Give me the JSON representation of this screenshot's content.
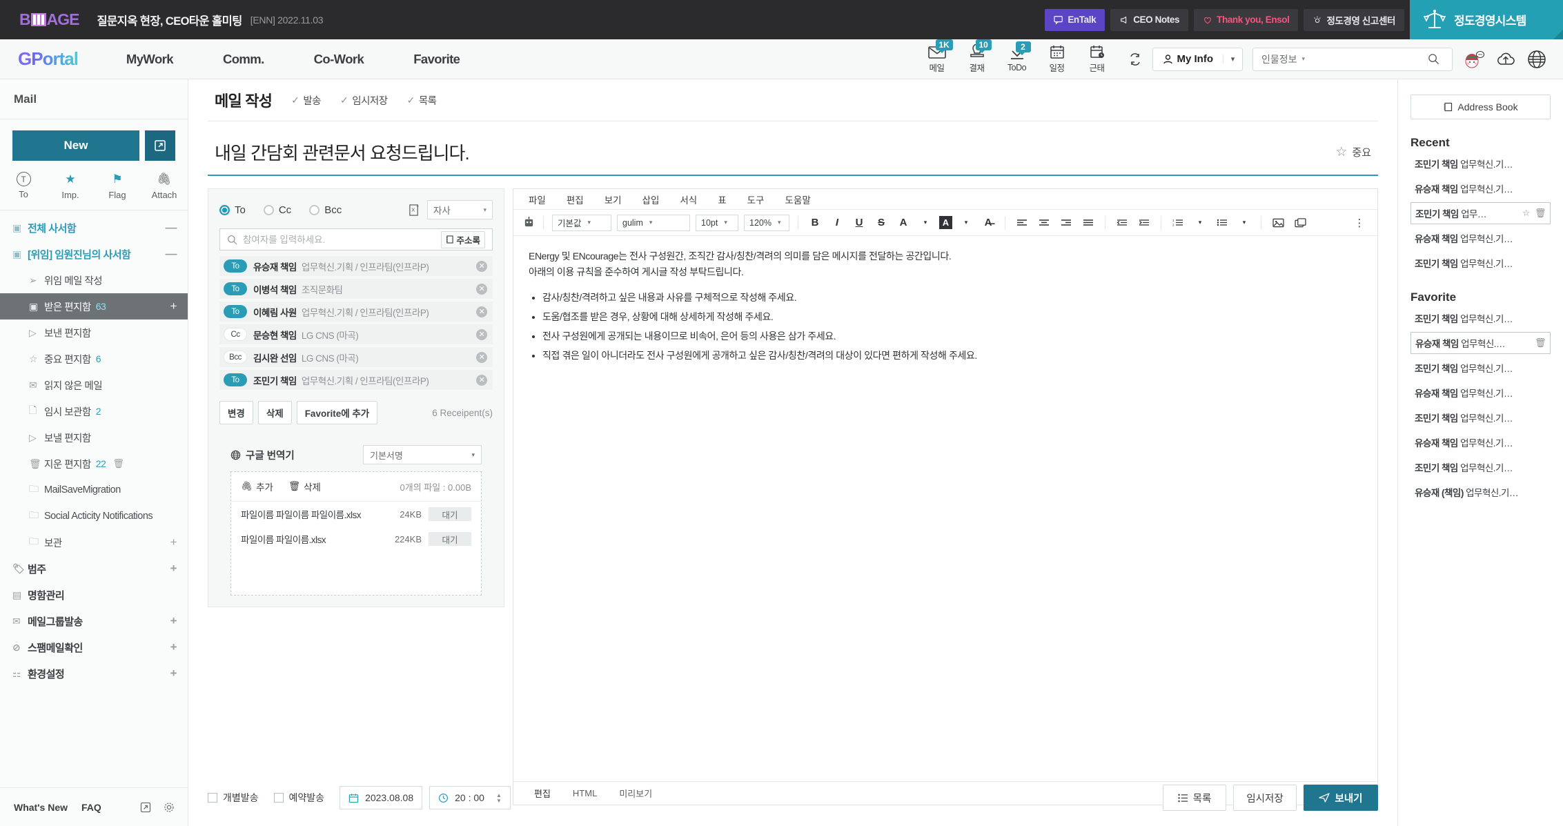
{
  "topbar": {
    "logo_text_left": "B",
    "logo_text_right": "AGE",
    "news_title": "질문지옥 현장, CEO타운 홀미팅",
    "news_date": "[ENN] 2022.11.03",
    "chips": [
      {
        "label": "EnTalk",
        "icon": "chat-icon",
        "style": "violet"
      },
      {
        "label": "CEO Notes",
        "icon": "megaphone-icon",
        "style": "dark"
      },
      {
        "label": "Thank you, Ensol",
        "icon": "heart-icon",
        "style": "dark-pink"
      },
      {
        "label": "정도경영 신고센터",
        "icon": "whistle-icon",
        "style": "dark"
      }
    ],
    "system_label": "정도경영시스템",
    "system_icon": "scales-icon",
    "accent_teal": "#24a0b5",
    "accent_violet": "#5b45c4",
    "pink": "#f5557f"
  },
  "navbar": {
    "brand_g": "G",
    "brand_rest": "Portal",
    "links": [
      "MyWork",
      "Comm.",
      "Co-Work",
      "Favorite"
    ],
    "tools": [
      {
        "label": "메일",
        "badge": "1K",
        "icon": "mail-icon"
      },
      {
        "label": "결재",
        "badge": "10",
        "icon": "stamp-icon"
      },
      {
        "label": "ToDo",
        "badge": "2",
        "icon": "check-icon"
      },
      {
        "label": "일정",
        "badge": "",
        "icon": "calendar-icon"
      },
      {
        "label": "근태",
        "badge": "",
        "icon": "calendar-clock-icon"
      }
    ],
    "refresh_icon": "refresh-icon",
    "myinfo_label": "My Info",
    "search_category": "인물정보",
    "search_value": "",
    "search_placeholder": "",
    "badge_color": "#2b9cb5"
  },
  "sidebar": {
    "title": "Mail",
    "new_label": "New",
    "new_window_icon": "open-in-new-icon",
    "quick": [
      {
        "label": "To",
        "icon": "to-circle-icon"
      },
      {
        "label": "Imp.",
        "icon": "star-icon"
      },
      {
        "label": "Flag",
        "icon": "flag-icon"
      },
      {
        "label": "Attach",
        "icon": "paperclip-icon"
      }
    ],
    "items": [
      {
        "label": "전체 사서함",
        "icon": "inbox-icon",
        "type": "head",
        "count": "",
        "right": "—"
      },
      {
        "label": "[위임] 임원진님의 사서함",
        "icon": "inbox-icon",
        "type": "head",
        "count": "",
        "right": "—"
      },
      {
        "label": "위임 메일 작성",
        "icon": "send-icon",
        "type": "sub",
        "count": "",
        "right": ""
      },
      {
        "label": "받은 편지함",
        "icon": "inbox-icon",
        "type": "sub-selected",
        "count": "63",
        "right": "+"
      },
      {
        "label": "보낸 편지함",
        "icon": "sent-icon",
        "type": "sub",
        "count": "",
        "right": ""
      },
      {
        "label": "중요 편지함",
        "icon": "star-outline-icon",
        "type": "sub",
        "count": "6",
        "right": ""
      },
      {
        "label": "읽지 않은 메일",
        "icon": "unread-icon",
        "type": "sub",
        "count": "",
        "right": ""
      },
      {
        "label": "임시 보관함",
        "icon": "draft-icon",
        "type": "sub",
        "count": "2",
        "right": ""
      },
      {
        "label": "보낼 편지함",
        "icon": "outbox-icon",
        "type": "sub",
        "count": "",
        "right": ""
      },
      {
        "label": "지운 편지함",
        "icon": "trash-icon",
        "type": "sub-trash",
        "count": "22",
        "right": ""
      },
      {
        "label": "MailSaveMigration",
        "icon": "folder-icon",
        "type": "sub",
        "count": "",
        "right": ""
      },
      {
        "label": "Social Acticity Notifications",
        "icon": "folder-icon",
        "type": "sub",
        "count": "",
        "right": ""
      },
      {
        "label": "보관",
        "icon": "folder-icon",
        "type": "sub",
        "count": "",
        "right": "+"
      },
      {
        "label": "범주",
        "icon": "tag-icon",
        "type": "bold",
        "count": "",
        "right": "+"
      },
      {
        "label": "명함관리",
        "icon": "card-icon",
        "type": "bold",
        "count": "",
        "right": ""
      },
      {
        "label": "메일그룹발송",
        "icon": "mail-group-icon",
        "type": "bold",
        "count": "",
        "right": "+"
      },
      {
        "label": "스팸메일확인",
        "icon": "ban-icon",
        "type": "bold",
        "count": "",
        "right": "+"
      },
      {
        "label": "환경설정",
        "icon": "sliders-icon",
        "type": "bold",
        "count": "",
        "right": "+"
      }
    ],
    "footer": {
      "whats_new": "What's New",
      "faq": "FAQ",
      "open_icon": "external-link-icon",
      "gear_icon": "gear-icon"
    }
  },
  "mail": {
    "page_title": "메일 작성",
    "head_actions": [
      "발송",
      "임시저장",
      "목록"
    ],
    "subject": "내일 간담회 관련문서 요청드립니다.",
    "important_label": "중요",
    "important_icon": "star-outline-icon"
  },
  "recipients": {
    "radios": [
      {
        "label": "To",
        "selected": true
      },
      {
        "label": "Cc",
        "selected": false
      },
      {
        "label": "Bcc",
        "selected": false
      }
    ],
    "excel_icon": "excel-icon",
    "self_select": "자사",
    "search_placeholder": "참여자를 입력하세요.",
    "search_value": "",
    "address_book_btn": "주소록",
    "address_book_icon": "book-icon",
    "list": [
      {
        "tag": "To",
        "name": "유승재 책임",
        "dept": "업무혁신.기획 / 인프라팀(인프라P)",
        "tag_style": "teal"
      },
      {
        "tag": "To",
        "name": "이병석 책임",
        "dept": "조직문화팀",
        "tag_style": "teal"
      },
      {
        "tag": "To",
        "name": "이혜림 사원",
        "dept": "업무혁신.기획 / 인프라팀(인프라P)",
        "tag_style": "teal"
      },
      {
        "tag": "Cc",
        "name": "문승현 책임",
        "dept": "LG CNS (마곡)",
        "tag_style": "plain"
      },
      {
        "tag": "Bcc",
        "name": "김시완 선임",
        "dept": "LG CNS (마곡)",
        "tag_style": "plain"
      },
      {
        "tag": "To",
        "name": "조민기 책임",
        "dept": "업무혁신.기획 / 인프라팀(인프라P)",
        "tag_style": "teal"
      }
    ],
    "actions": [
      "변경",
      "삭제",
      "Favorite에 추가"
    ],
    "count_text": "6 Receipent(s)"
  },
  "translator": {
    "label": "구글 번역기",
    "icon": "globe-icon",
    "signature_value": "기본서명"
  },
  "attachments": {
    "add_label": "추가",
    "add_icon": "paperclip-icon",
    "delete_label": "삭제",
    "delete_icon": "trash-icon",
    "summary": "0개의 파일 : 0.00B",
    "files": [
      {
        "name": "파일이름 파일이름 파일이름.xlsx",
        "size": "24KB",
        "status": "대기"
      },
      {
        "name": "파일이름 파일이름.xlsx",
        "size": "224KB",
        "status": "대기"
      }
    ]
  },
  "editor": {
    "menu": [
      "파일",
      "편집",
      "보기",
      "삽입",
      "서식",
      "표",
      "도구",
      "도움말"
    ],
    "robot_icon": "robot-icon",
    "style_value": "기본값",
    "font_value": "gulim",
    "size_value": "10pt",
    "zoom_value": "120%",
    "format_buttons": [
      "B",
      "I",
      "U",
      "S"
    ],
    "more_icon": "more-vertical-icon",
    "body_paragraphs": [
      "ENergy 및 ENcourage는 전사 구성원간, 조직간 감사/칭찬/격려의 의미를 담은 메시지를 전달하는 공간입니다.",
      "아래의 이용 규칙을 준수하여 게시글 작성 부탁드립니다."
    ],
    "body_bullets": [
      "감사/칭찬/격려하고 싶은 내용과 사유를 구체적으로 작성해 주세요.",
      "도움/협조를 받은 경우, 상황에 대해 상세하게 작성해 주세요.",
      "전사 구성원에게 공개되는 내용이므로 비속어, 은어 등의 사용은 삼가 주세요.",
      "직접 겪은 일이 아니더라도 전사 구성원에게 공개하고 싶은 감사/칭찬/격려의 대상이 있다면 편하게 작성해 주세요."
    ],
    "tabs": [
      {
        "label": "편집",
        "active": true
      },
      {
        "label": "HTML",
        "active": false
      },
      {
        "label": "미리보기",
        "active": false
      }
    ]
  },
  "bottom": {
    "individual_send": "개별발송",
    "scheduled_send": "예약발송",
    "date_value": "2023.08.08",
    "date_icon": "calendar-icon",
    "time_value": "20 : 00",
    "time_icon": "clock-icon",
    "list_btn": "목록",
    "list_icon": "list-icon",
    "draft_btn": "임시저장",
    "send_btn": "보내기",
    "send_icon": "send-icon"
  },
  "rightpanel": {
    "address_book_btn": "Address Book",
    "address_book_icon": "book-icon",
    "recent_title": "Recent",
    "recent_items": [
      {
        "name": "조민기 책임",
        "detail": "업무혁신.기…",
        "boxed": false
      },
      {
        "name": "유승재 책임",
        "detail": "업무혁신.기…",
        "boxed": false
      },
      {
        "name": "조민기 책임",
        "detail": "업무…",
        "boxed": true
      },
      {
        "name": "유승재 책임",
        "detail": "업무혁신.기…",
        "boxed": false
      },
      {
        "name": "조민기 책임",
        "detail": "업무혁신.기…",
        "boxed": false
      }
    ],
    "favorite_title": "Favorite",
    "favorite_items": [
      {
        "name": "조민기 책임",
        "detail": "업무혁신.기…",
        "boxed": false
      },
      {
        "name": "유승재 책임",
        "detail": "업무혁신.…",
        "boxed": true
      },
      {
        "name": "조민기 책임",
        "detail": "업무혁신.기…",
        "boxed": false
      },
      {
        "name": "유승재 책임",
        "detail": "업무혁신.기…",
        "boxed": false
      },
      {
        "name": "조민기 책임",
        "detail": "업무혁신.기…",
        "boxed": false
      },
      {
        "name": "유승재 책임",
        "detail": "업무혁신.기…",
        "boxed": false
      },
      {
        "name": "조민기 책임",
        "detail": "업무혁신.기…",
        "boxed": false
      },
      {
        "name": "유승재 (책임)",
        "detail": "업무혁신.기…",
        "boxed": false
      }
    ],
    "star_icon": "star-outline-icon",
    "trash_icon": "trash-icon"
  }
}
